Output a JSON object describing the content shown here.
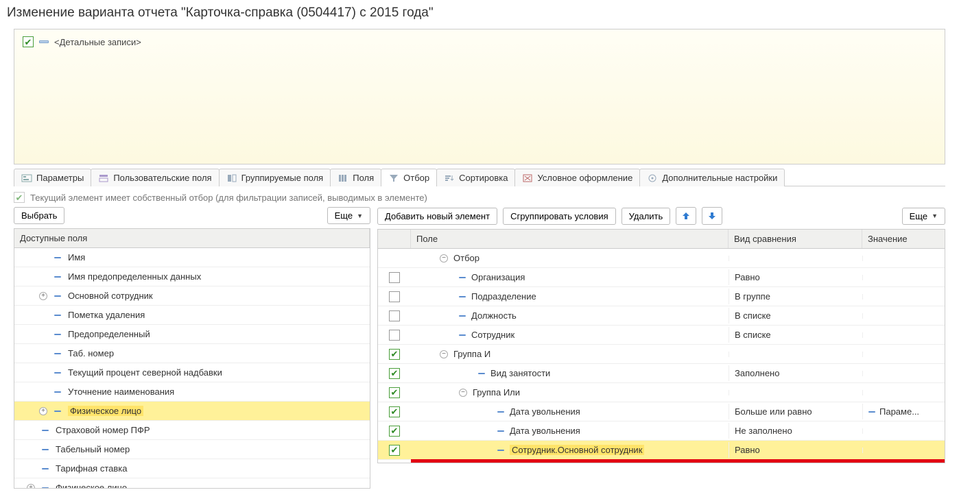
{
  "window_title": "Изменение варианта отчета \"Карточка-справка (0504417) с 2015 года\"",
  "top": {
    "detail_records": "<Детальные записи>"
  },
  "tabs": {
    "params": "Параметры",
    "user_fields": "Пользовательские поля",
    "group_fields": "Группируемые поля",
    "fields": "Поля",
    "filter": "Отбор",
    "sort": "Сортировка",
    "cond_format": "Условное оформление",
    "extra": "Дополнительные настройки"
  },
  "subline": "Текущий элемент имеет собственный отбор (для фильтрации записей, выводимых в элементе)",
  "left": {
    "choose": "Выбрать",
    "more": "Еще",
    "header": "Доступные поля",
    "rows": [
      {
        "key": "name",
        "label": "Имя"
      },
      {
        "key": "predef_name",
        "label": "Имя предопределенных данных"
      },
      {
        "key": "main_emp",
        "label": "Основной сотрудник",
        "expandable": true
      },
      {
        "key": "del_mark",
        "label": "Пометка удаления"
      },
      {
        "key": "predef",
        "label": "Предопределенный"
      },
      {
        "key": "tab_no",
        "label": "Таб. номер"
      },
      {
        "key": "north_pct",
        "label": "Текущий процент северной надбавки"
      },
      {
        "key": "name_clar",
        "label": "Уточнение наименования"
      },
      {
        "key": "phys",
        "label": "Физическое лицо",
        "expandable": true,
        "highlight": true
      },
      {
        "key": "pfr",
        "label": "Страховой номер ПФР",
        "outdent": true
      },
      {
        "key": "tab_no2",
        "label": "Табельный номер",
        "outdent": true
      },
      {
        "key": "rate",
        "label": "Тарифная ставка",
        "outdent": true
      },
      {
        "key": "phys2",
        "label": "Физическое лицо",
        "outdent": true,
        "expandable": true
      }
    ]
  },
  "right": {
    "add": "Добавить новый элемент",
    "group": "Сгруппировать условия",
    "delete": "Удалить",
    "more": "Еще",
    "header_field": "Поле",
    "header_comp": "Вид сравнения",
    "header_val": "Значение",
    "rows": [
      {
        "type": "root",
        "label": "Отбор"
      },
      {
        "type": "item",
        "checked": false,
        "indent": 2,
        "label": "Организация",
        "comp": "Равно"
      },
      {
        "type": "item",
        "checked": false,
        "indent": 2,
        "label": "Подразделение",
        "comp": "В группе"
      },
      {
        "type": "item",
        "checked": false,
        "indent": 2,
        "label": "Должность",
        "comp": "В списке"
      },
      {
        "type": "item",
        "checked": false,
        "indent": 2,
        "label": "Сотрудник",
        "comp": "В списке"
      },
      {
        "type": "group",
        "checked": true,
        "indent": 1,
        "label": "Группа И"
      },
      {
        "type": "item",
        "checked": true,
        "indent": 3,
        "label": "Вид занятости",
        "comp": "Заполнено"
      },
      {
        "type": "group",
        "checked": true,
        "indent": 2,
        "label": "Группа Или"
      },
      {
        "type": "item",
        "checked": true,
        "indent": 4,
        "label": "Дата увольнения",
        "comp": "Больше или равно",
        "val": "Параме..."
      },
      {
        "type": "item",
        "checked": true,
        "indent": 4,
        "label": "Дата увольнения",
        "comp": "Не заполнено"
      },
      {
        "type": "item",
        "checked": true,
        "indent": 4,
        "label": "Сотрудник.Основной сотрудник",
        "comp": "Равно",
        "selected": true
      }
    ]
  }
}
